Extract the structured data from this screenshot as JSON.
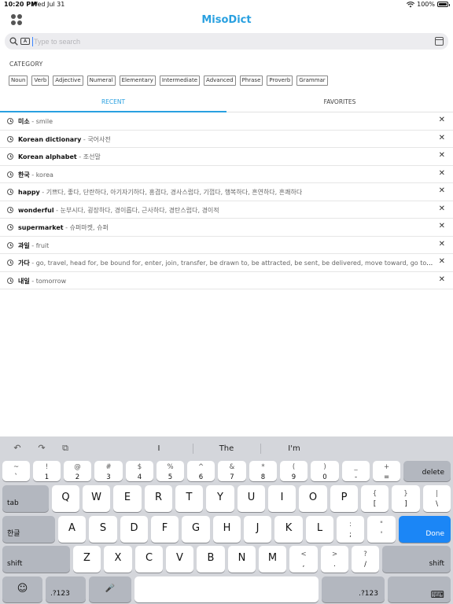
{
  "status": {
    "time": "10:20 PM",
    "date": "Wed Jul 31",
    "battery": "100%",
    "battery_level": 1.0
  },
  "header": {
    "title": "MisoDict"
  },
  "search": {
    "keyboard_toggle": "A",
    "placeholder": "Type to search",
    "value": ""
  },
  "category": {
    "label": "CATEGORY",
    "chips": [
      "Noun",
      "Verb",
      "Adjective",
      "Numeral",
      "Elementary",
      "Intermediate",
      "Advanced",
      "Phrase",
      "Proverb",
      "Grammar"
    ]
  },
  "tabs": [
    {
      "label": "RECENT",
      "active": true
    },
    {
      "label": "FAVORITES",
      "active": false
    }
  ],
  "history": [
    {
      "word": "미소",
      "meaning": " - smile"
    },
    {
      "word": "Korean dictionary",
      "meaning": " - 국어사전"
    },
    {
      "word": "Korean alphabet",
      "meaning": " - 조선말"
    },
    {
      "word": "한국",
      "meaning": " - korea"
    },
    {
      "word": "happy",
      "meaning": " - 기쁘다, 좋다, 단란하다, 아기자기하다, 흥겹다, 경사스럽다, 기껍다, 행복하다, 흔연하다, 흔쾌하다"
    },
    {
      "word": "wonderful",
      "meaning": " - 눈부시다, 굉장하다, 경이롭다, 근사하다, 경탄스럽다, 경이적"
    },
    {
      "word": "supermarket",
      "meaning": " - 슈퍼마켓, 슈퍼"
    },
    {
      "word": "과일",
      "meaning": " - fruit"
    },
    {
      "word": "가다",
      "meaning": " - go, travel, head for, be bound for, enter, join, transfer, be drawn to, be attracted, be sent, be delivered, move toward, go toward, re..."
    },
    {
      "word": "내일",
      "meaning": " - tomorrow"
    }
  ],
  "history_delete_glyph": "✕",
  "keyboard": {
    "suggestions": [
      "I",
      "The",
      "I'm"
    ],
    "tools": {
      "undo": "↶",
      "redo": "↷",
      "paste": "⧉"
    },
    "row1": [
      {
        "top": "~",
        "bot": "`"
      },
      {
        "top": "!",
        "bot": "1"
      },
      {
        "top": "@",
        "bot": "2"
      },
      {
        "top": "#",
        "bot": "3"
      },
      {
        "top": "$",
        "bot": "4"
      },
      {
        "top": "%",
        "bot": "5"
      },
      {
        "top": "^",
        "bot": "6"
      },
      {
        "top": "&",
        "bot": "7"
      },
      {
        "top": "*",
        "bot": "8"
      },
      {
        "top": "(",
        "bot": "9"
      },
      {
        "top": ")",
        "bot": "0"
      },
      {
        "top": "_",
        "bot": "-"
      },
      {
        "top": "+",
        "bot": "="
      }
    ],
    "delete": "delete",
    "tab": "tab",
    "row2": [
      "Q",
      "W",
      "E",
      "R",
      "T",
      "Y",
      "U",
      "I",
      "O",
      "P"
    ],
    "row2_extra": [
      {
        "top": "{",
        "bot": "["
      },
      {
        "top": "}",
        "bot": "]"
      },
      {
        "top": "|",
        "bot": "\\"
      }
    ],
    "hangul": "한글",
    "row3": [
      "A",
      "S",
      "D",
      "F",
      "G",
      "H",
      "J",
      "K",
      "L"
    ],
    "row3_extra": [
      {
        "top": ":",
        "bot": ";"
      },
      {
        "top": "\"",
        "bot": "'"
      }
    ],
    "done": "Done",
    "shift": "shift",
    "row4": [
      "Z",
      "X",
      "C",
      "V",
      "B",
      "N",
      "M"
    ],
    "row4_extra": [
      {
        "top": "<",
        "bot": ","
      },
      {
        "top": ">",
        "bot": "."
      },
      {
        "top": "?",
        "bot": "/"
      }
    ],
    "emoji": "☺",
    "numbers": ".?123",
    "mic": "🎤",
    "space": "",
    "hide": "⌨"
  }
}
